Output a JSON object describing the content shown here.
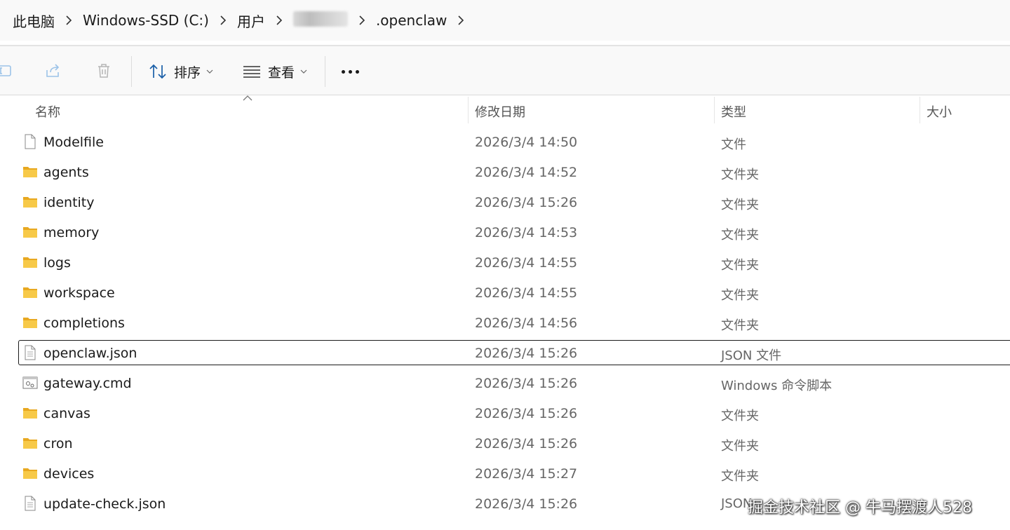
{
  "breadcrumb": {
    "items": [
      "此电脑",
      "Windows-SSD (C:)",
      "用户",
      "",
      ".openclaw"
    ]
  },
  "toolbar": {
    "sort_label": "排序",
    "view_label": "查看"
  },
  "columns": {
    "name": "名称",
    "modified": "修改日期",
    "type": "类型",
    "size": "大小"
  },
  "files": [
    {
      "name": "Modelfile",
      "date": "2026/3/4 14:50",
      "type": "文件",
      "icon": "file-icon"
    },
    {
      "name": "agents",
      "date": "2026/3/4 14:52",
      "type": "文件夹",
      "icon": "folder-icon"
    },
    {
      "name": "identity",
      "date": "2026/3/4 15:26",
      "type": "文件夹",
      "icon": "folder-icon"
    },
    {
      "name": "memory",
      "date": "2026/3/4 14:53",
      "type": "文件夹",
      "icon": "folder-icon"
    },
    {
      "name": "logs",
      "date": "2026/3/4 14:55",
      "type": "文件夹",
      "icon": "folder-icon"
    },
    {
      "name": "workspace",
      "date": "2026/3/4 14:55",
      "type": "文件夹",
      "icon": "folder-icon"
    },
    {
      "name": "completions",
      "date": "2026/3/4 14:56",
      "type": "文件夹",
      "icon": "folder-icon"
    },
    {
      "name": "openclaw.json",
      "date": "2026/3/4 15:26",
      "type": "JSON 文件",
      "icon": "json-file-icon",
      "selected": true
    },
    {
      "name": "gateway.cmd",
      "date": "2026/3/4 15:26",
      "type": "Windows 命令脚本",
      "icon": "script-file-icon"
    },
    {
      "name": "canvas",
      "date": "2026/3/4 15:26",
      "type": "文件夹",
      "icon": "folder-icon"
    },
    {
      "name": "cron",
      "date": "2026/3/4 15:26",
      "type": "文件夹",
      "icon": "folder-icon"
    },
    {
      "name": "devices",
      "date": "2026/3/4 15:27",
      "type": "文件夹",
      "icon": "folder-icon"
    },
    {
      "name": "update-check.json",
      "date": "2026/3/4 15:26",
      "type": "JSON",
      "icon": "json-file-icon"
    }
  ],
  "watermark": "掘金技术社区 @ 牛马摆渡人528",
  "colors": {
    "folder": "#f7c948",
    "folder_dark": "#e8a820",
    "toolbar_bg": "#f9f9f9",
    "selection_border": "#1a1a1a"
  }
}
